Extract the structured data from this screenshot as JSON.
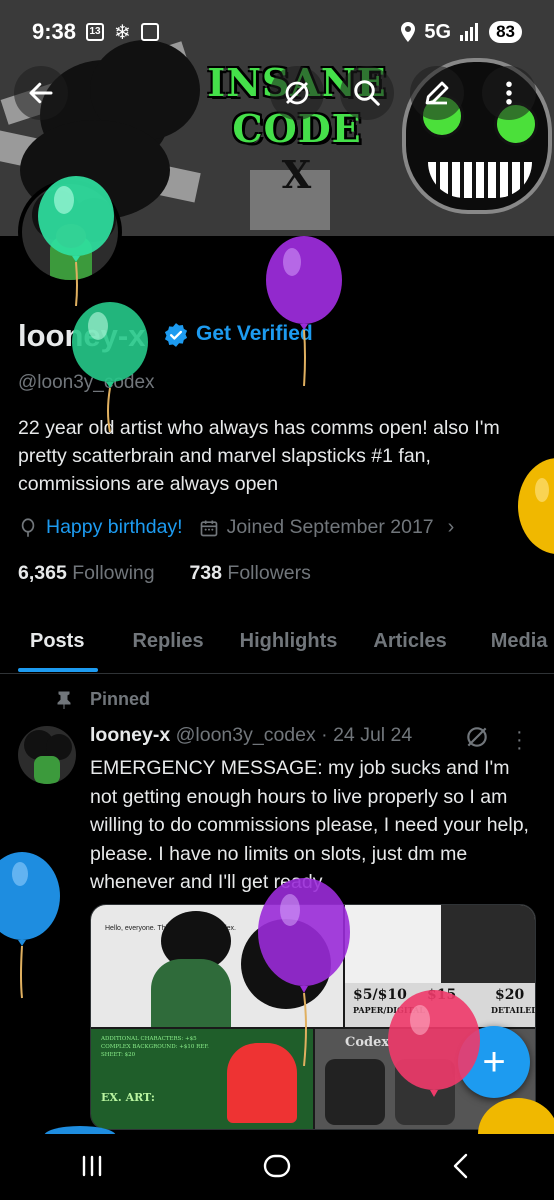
{
  "status_bar": {
    "time": "9:38",
    "date_badge": "13",
    "network": "5G",
    "battery": "83"
  },
  "banner": {
    "title_line1": "INSANE",
    "title_line2": "CODE",
    "title_line3": "X"
  },
  "profile": {
    "name": "looney-x",
    "get_verified": "Get Verified",
    "handle": "@loon3y_codex",
    "bio": "22 year old artist who always has comms open! also I'm pretty scatterbrain and marvel slapsticks #1 fan, commissions are always open",
    "birthday_text": "Happy birthday!",
    "joined_text": "Joined September 2017",
    "following_count": "6,365",
    "following_label": "Following",
    "followers_count": "738",
    "followers_label": "Followers"
  },
  "tabs": [
    "Posts",
    "Replies",
    "Highlights",
    "Articles",
    "Media"
  ],
  "pinned_label": "Pinned",
  "post": {
    "author": "looney-x",
    "handle": "@loon3y_codex",
    "date": "· 24 Jul 24",
    "text": "EMERGENCY MESSAGE: my job sucks and I'm not getting enough hours to live properly so I am willing to do commissions please, I need your help, please. I have no limits on slots, just dm me whenever and I'll get ready",
    "media_caption": "Hello, everyone. This is Kallus aka Codex.",
    "media_prices": [
      "$5/$10",
      "$15",
      "$20"
    ],
    "media_price_labels": [
      "PAPER/DIGITAL",
      "DETAILED"
    ],
    "media_note": "ADDITIONAL CHARACTERS: +$5 COMPLEX BACKGROUND: +$10 REF. SHEET: $20",
    "media_ex": "EX. ART:",
    "media_codex": "Codex"
  },
  "icons": {
    "back": "arrow-left-icon",
    "grok": "grok-icon",
    "search": "search-icon",
    "edit": "edit-icon",
    "more": "more-vertical-icon",
    "compose": "plus-icon"
  },
  "colors": {
    "accent": "#1d9bf0",
    "background": "#000000",
    "text": "#e7e9ea",
    "muted": "#71767b"
  }
}
